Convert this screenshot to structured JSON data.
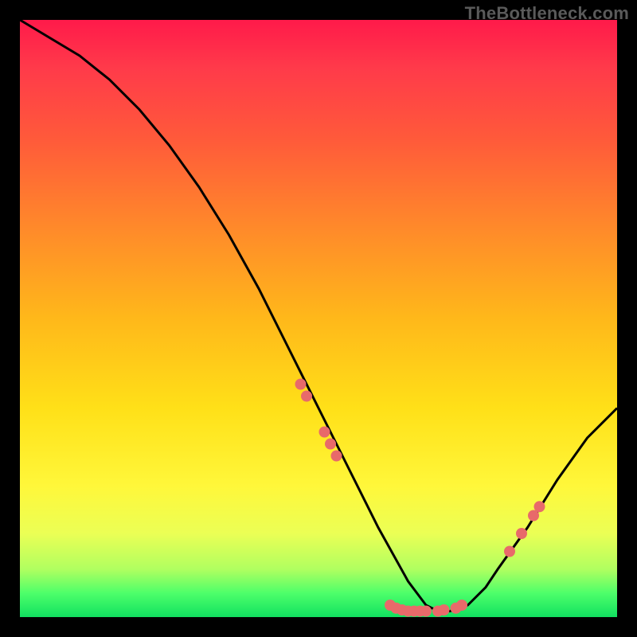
{
  "watermark": "TheBottleneck.com",
  "chart_data": {
    "type": "line",
    "title": "",
    "xlabel": "",
    "ylabel": "",
    "xlim": [
      0,
      100
    ],
    "ylim": [
      0,
      100
    ],
    "series": [
      {
        "name": "bottleneck-curve",
        "x": [
          0,
          5,
          10,
          15,
          20,
          25,
          30,
          35,
          40,
          45,
          50,
          55,
          60,
          65,
          68,
          70,
          72,
          75,
          78,
          80,
          85,
          90,
          95,
          100
        ],
        "y": [
          100,
          97,
          94,
          90,
          85,
          79,
          72,
          64,
          55,
          45,
          35,
          25,
          15,
          6,
          2,
          1,
          1,
          2,
          5,
          8,
          15,
          23,
          30,
          35
        ]
      }
    ],
    "markers": [
      {
        "x": 47,
        "y": 39
      },
      {
        "x": 48,
        "y": 37
      },
      {
        "x": 51,
        "y": 31
      },
      {
        "x": 52,
        "y": 29
      },
      {
        "x": 53,
        "y": 27
      },
      {
        "x": 62,
        "y": 2
      },
      {
        "x": 63,
        "y": 1.5
      },
      {
        "x": 64,
        "y": 1.2
      },
      {
        "x": 65,
        "y": 1
      },
      {
        "x": 66,
        "y": 1
      },
      {
        "x": 67,
        "y": 1
      },
      {
        "x": 68,
        "y": 1
      },
      {
        "x": 70,
        "y": 1
      },
      {
        "x": 71,
        "y": 1.2
      },
      {
        "x": 73,
        "y": 1.5
      },
      {
        "x": 74,
        "y": 2
      },
      {
        "x": 82,
        "y": 11
      },
      {
        "x": 84,
        "y": 14
      },
      {
        "x": 86,
        "y": 17
      },
      {
        "x": 87,
        "y": 18.5
      }
    ],
    "marker_color": "#e86a6a",
    "curve_color": "#000000",
    "gradient_stops": [
      {
        "pos": 0,
        "color": "#ff1a4a"
      },
      {
        "pos": 35,
        "color": "#ff8a2a"
      },
      {
        "pos": 65,
        "color": "#ffe018"
      },
      {
        "pos": 92,
        "color": "#b0ff60"
      },
      {
        "pos": 100,
        "color": "#11e060"
      }
    ]
  }
}
